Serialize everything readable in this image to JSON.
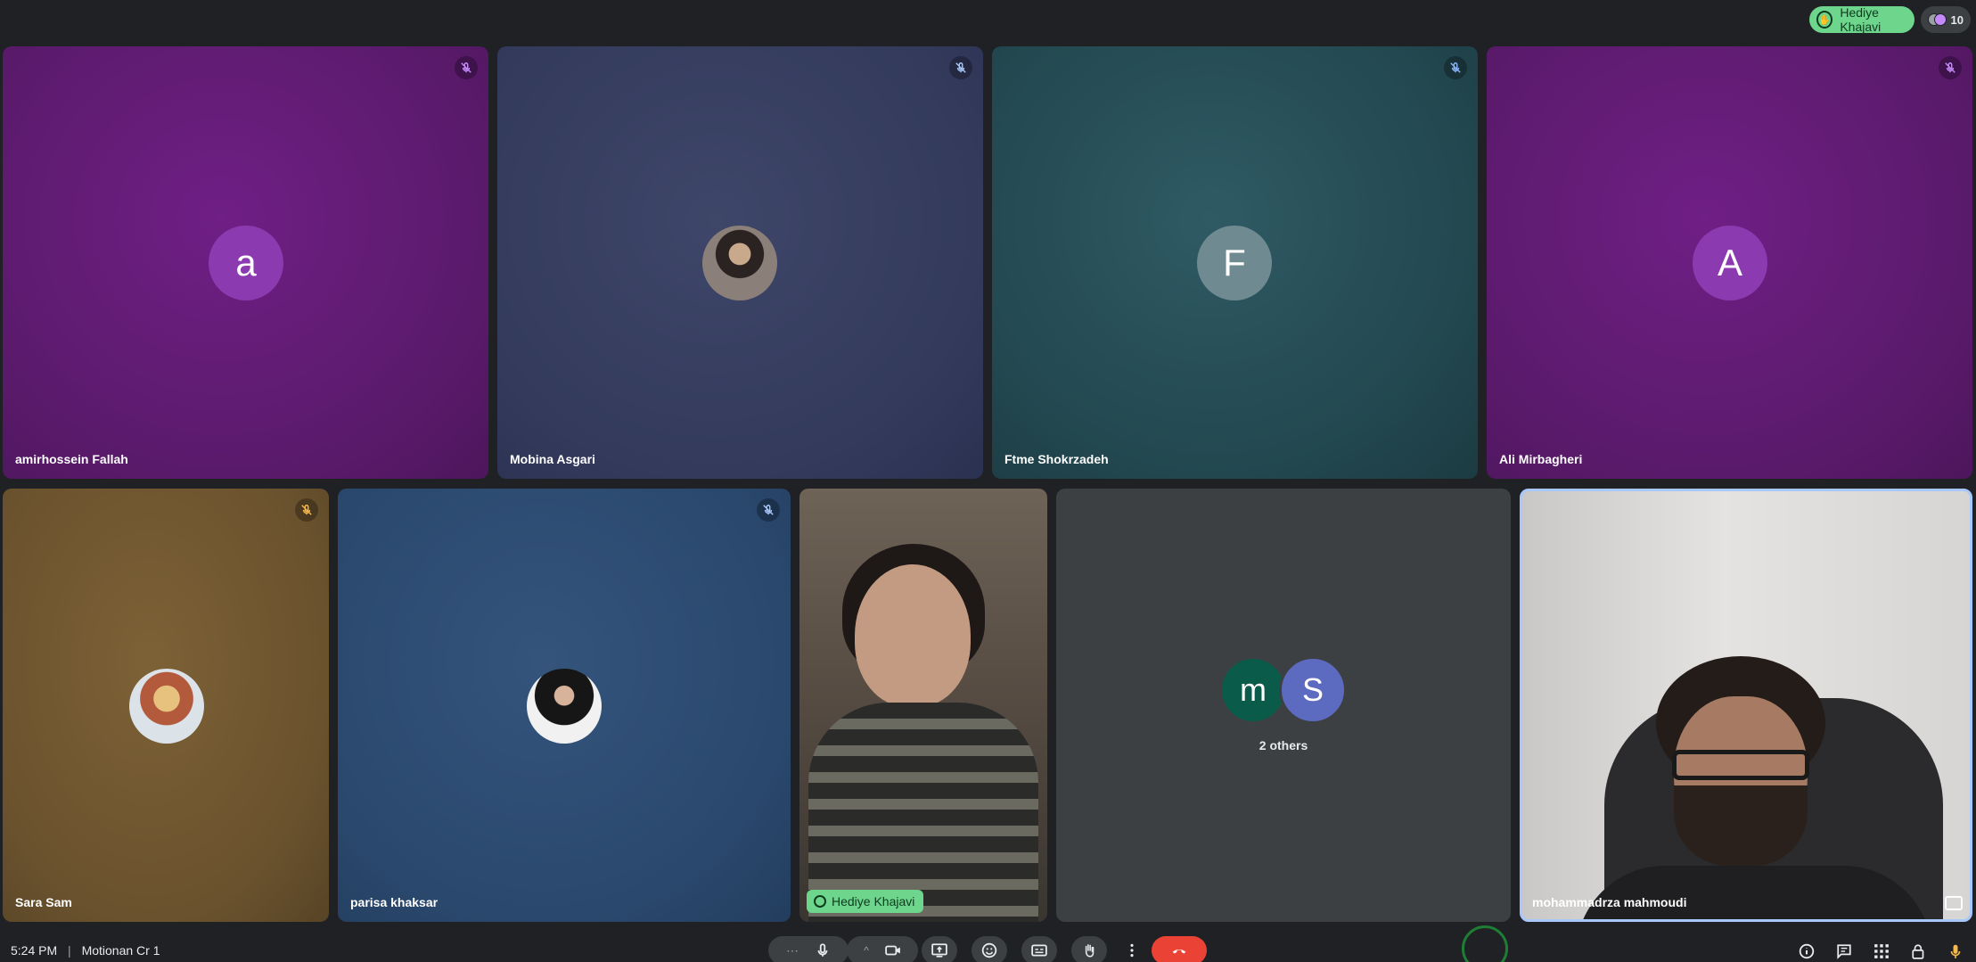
{
  "top": {
    "hand_raised_name": "Hediye Khajavi",
    "participant_count": "10"
  },
  "tiles": [
    {
      "name": "amirhossein Fallah",
      "initial": "a",
      "avatar_color": "#8b3ab0"
    },
    {
      "name": "Mobina Asgari",
      "initial": ""
    },
    {
      "name": "Ftme Shokrzadeh",
      "initial": "F",
      "avatar_color": "#6f8a90"
    },
    {
      "name": "Ali Mirbagheri",
      "initial": "A",
      "avatar_color": "#8b3ab0"
    },
    {
      "name": "Sara Sam",
      "initial": ""
    },
    {
      "name": "parisa khaksar",
      "initial": ""
    },
    {
      "name": "Hediye Khajavi"
    },
    {
      "name": "mohammadrza mahmoudi"
    }
  ],
  "others": {
    "label": "2 others",
    "avatars": [
      {
        "initial": "m",
        "color": "#0b5b4a"
      },
      {
        "initial": "S",
        "color": "#5c6bc0"
      }
    ]
  },
  "bottom": {
    "time": "5:24 PM",
    "meeting_name": "Motionan Cr 1",
    "time_separator": "|",
    "more_label": "⋯",
    "chevron_label": "^"
  },
  "colors": {
    "accent_green": "#6dd58c",
    "end_call_red": "#ea4335",
    "active_border": "#a8c7fa"
  }
}
